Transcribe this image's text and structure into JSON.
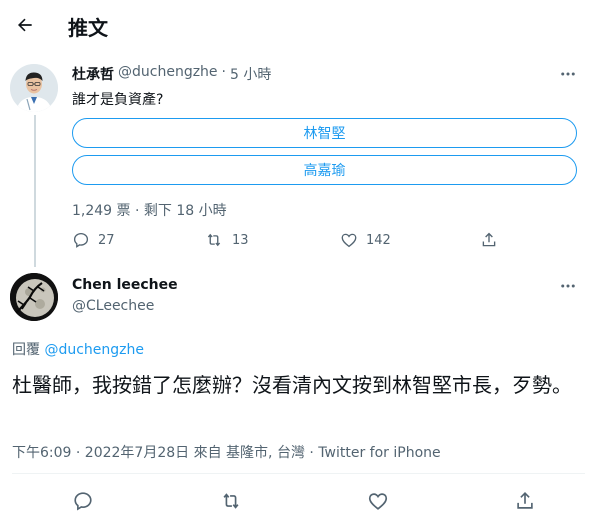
{
  "header": {
    "title": "推文"
  },
  "tweet1": {
    "name": "杜承哲",
    "handle": "@duchengzhe",
    "separator": "·",
    "time": "5 小時",
    "text": "誰才是負資產?",
    "poll": {
      "options": [
        "林智堅",
        "高嘉瑜"
      ],
      "meta": "1,249 票 · 剩下 18 小時"
    },
    "actions": {
      "replies": "27",
      "retweets": "13",
      "likes": "142"
    }
  },
  "tweet2": {
    "name": "Chen leechee",
    "handle": "@CLeechee",
    "reply_prefix": "回覆",
    "reply_handle": "@duchengzhe",
    "text": "杜醫師，我按錯了怎麼辦？沒看清內文按到林智堅市長，歹勢。",
    "timestamp": "下午6:09 · 2022年7月28日 來自 基隆市, 台灣 · ",
    "source": "Twitter for iPhone"
  },
  "colors": {
    "accent": "#1d9bf0",
    "muted": "#536471",
    "border": "#eff3f4"
  }
}
